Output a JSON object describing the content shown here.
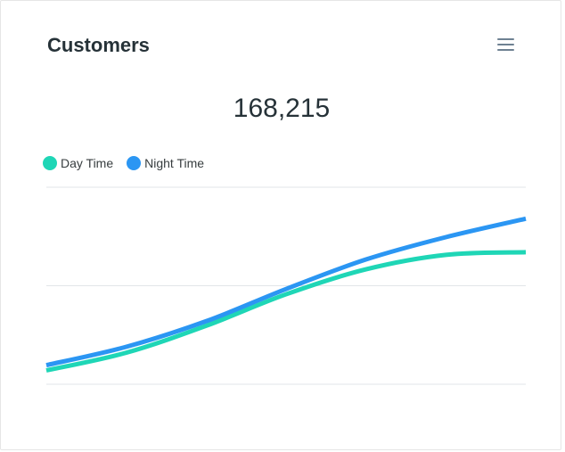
{
  "card": {
    "title": "Customers",
    "total": "168,215",
    "menu_icon": "hamburger-menu-icon"
  },
  "colors": {
    "day": "#1fd6b6",
    "night": "#2b96f3",
    "grid": "#e2e5e8"
  },
  "chart_data": {
    "type": "line",
    "smooth": true,
    "grid": true,
    "legend_position": "top-left",
    "x_ticks_visible": false,
    "y_ticks_visible": false,
    "ylim": [
      0,
      30
    ],
    "x": [
      1,
      2,
      3,
      4,
      5,
      6,
      7
    ],
    "series": [
      {
        "name": "Day Time",
        "values": [
          2.1,
          4.8,
          8.9,
          13.7,
          17.5,
          19.7,
          20.1
        ]
      },
      {
        "name": "Night Time",
        "values": [
          2.9,
          5.7,
          9.6,
          14.5,
          19.0,
          22.4,
          25.2
        ]
      }
    ]
  }
}
